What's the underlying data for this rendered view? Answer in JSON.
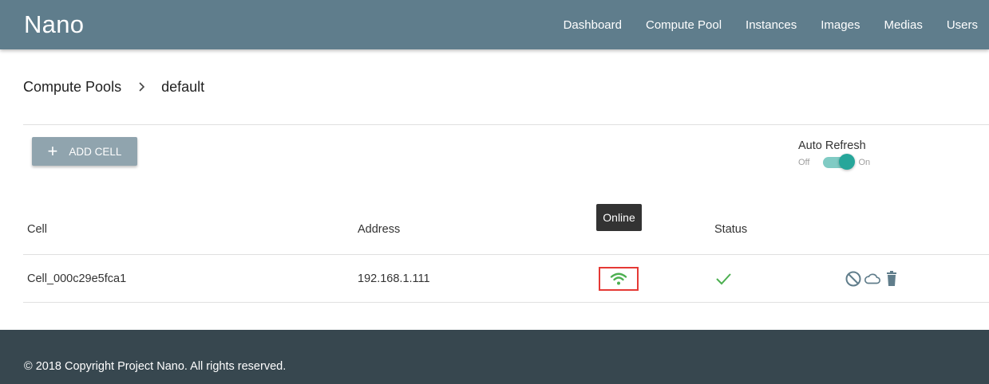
{
  "app": {
    "title": "Nano"
  },
  "nav": {
    "items": [
      {
        "label": "Dashboard"
      },
      {
        "label": "Compute Pool"
      },
      {
        "label": "Instances"
      },
      {
        "label": "Images"
      },
      {
        "label": "Medias"
      },
      {
        "label": "Users"
      }
    ]
  },
  "breadcrumb": {
    "parent": "Compute Pools",
    "current": "default"
  },
  "toolbar": {
    "add_label": "ADD CELL",
    "auto_refresh": {
      "label": "Auto Refresh",
      "off": "Off",
      "on": "On",
      "enabled": true
    }
  },
  "table": {
    "headers": {
      "cell": "Cell",
      "address": "Address",
      "status": "Status"
    },
    "tooltip": "Online",
    "rows": [
      {
        "cell": "Cell_000c29e5fca1",
        "address": "192.168.1.111",
        "online": true,
        "status_ok": true
      }
    ]
  },
  "footer": {
    "text": "© 2018 Copyright Project Nano. All rights reserved."
  },
  "colors": {
    "appbar": "#5f7d8c",
    "footer": "#37474f",
    "online": "#4caf50",
    "toggle": "#26a69a",
    "highlight": "#e53935"
  }
}
